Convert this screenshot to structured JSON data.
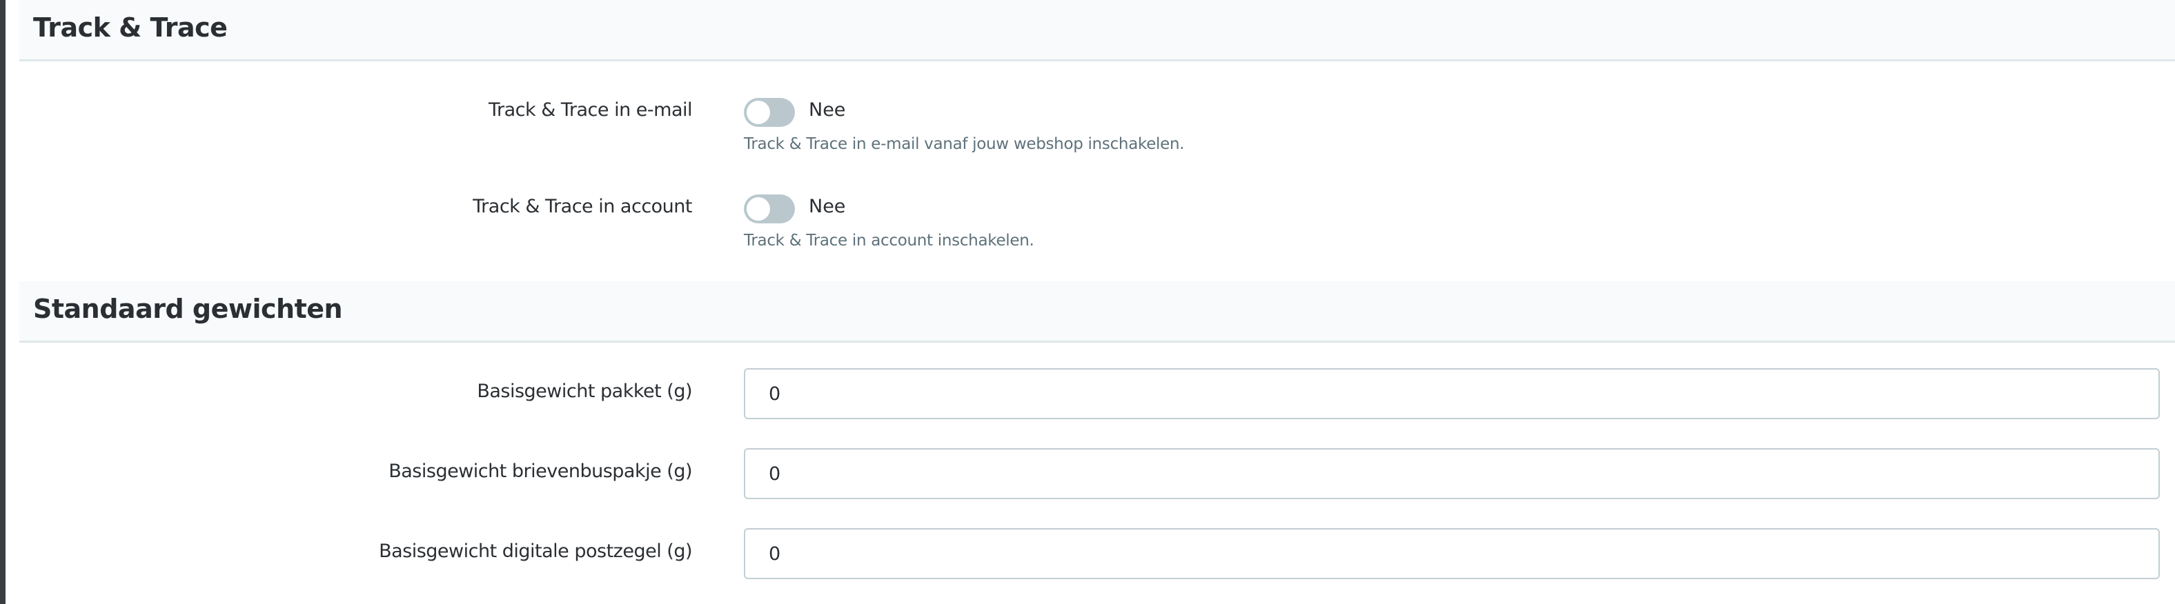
{
  "track_trace": {
    "title": "Track & Trace",
    "rows": [
      {
        "label": "Track & Trace in e-mail",
        "state": "Nee",
        "enabled": false,
        "help": "Track & Trace in e-mail vanaf jouw webshop inschakelen."
      },
      {
        "label": "Track & Trace in account",
        "state": "Nee",
        "enabled": false,
        "help": "Track & Trace in account inschakelen."
      }
    ]
  },
  "weights": {
    "title": "Standaard gewichten",
    "fields": [
      {
        "label": "Basisgewicht pakket (g)",
        "value": "0"
      },
      {
        "label": "Basisgewicht brievenbuspakje (g)",
        "value": "0"
      },
      {
        "label": "Basisgewicht digitale postzegel (g)",
        "value": "0"
      }
    ]
  }
}
